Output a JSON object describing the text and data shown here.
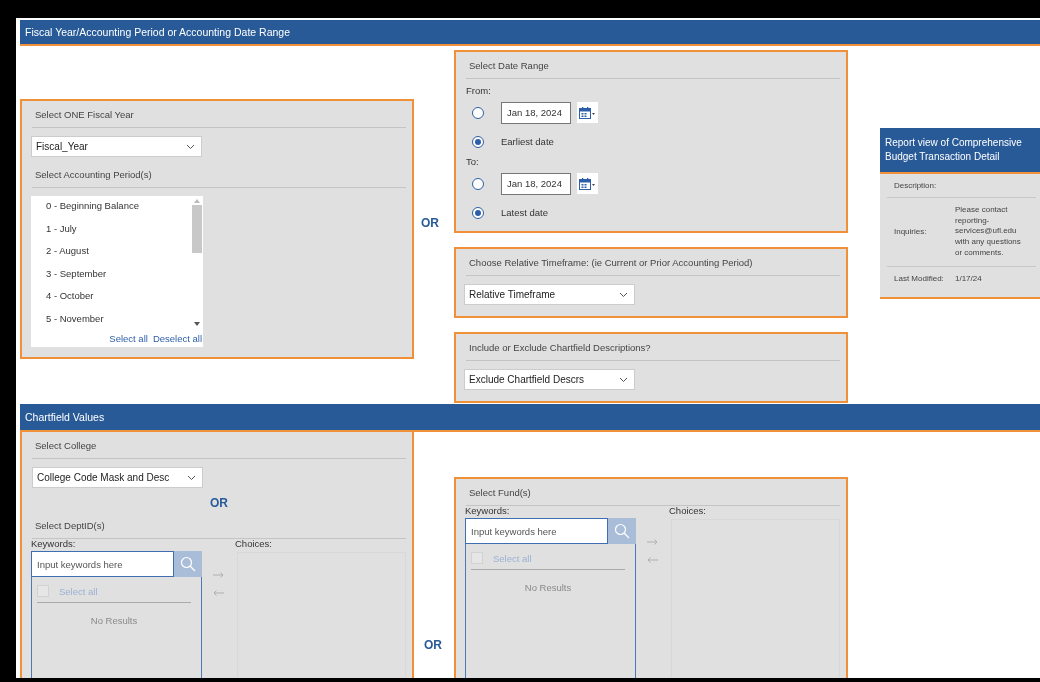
{
  "report_bar": {
    "title": "Fiscal Year/Accounting Period or Accounting Date Range"
  },
  "fiscal_year": {
    "heading": "Select ONE Fiscal Year",
    "dropdown": "Fiscal_Year",
    "periods_heading": "Select Accounting Period(s)",
    "periods": [
      {
        "label": "0 - Beginning Balance",
        "selected": false
      },
      {
        "label": "1 - July",
        "selected": false
      },
      {
        "label": "2 - August",
        "selected": false
      },
      {
        "label": "3 - September",
        "selected": false
      },
      {
        "label": "4 - October",
        "selected": false
      },
      {
        "label": "5 - November",
        "selected": false
      }
    ],
    "select_all": "Select all",
    "deselect_all": "Deselect all"
  },
  "top_or": "OR",
  "date_range": {
    "heading": "Select Date Range",
    "groups": [
      {
        "label": "From:",
        "options": [
          {
            "kind": "date",
            "value": "Jan 18, 2024",
            "selected": false
          },
          {
            "kind": "text",
            "label": "Earliest date",
            "selected": true
          }
        ]
      },
      {
        "label": "To:",
        "options": [
          {
            "kind": "date",
            "value": "Jan 18, 2024",
            "selected": false
          },
          {
            "kind": "text",
            "label": "Latest date",
            "selected": true
          }
        ]
      }
    ]
  },
  "relative_timeframe": {
    "heading": "Choose Relative Timeframe: (ie Current or Prior Accounting Period)",
    "dropdown": "Relative Timeframe"
  },
  "descriptions": {
    "heading": "Include or Exclude Chartfield Descriptions?",
    "dropdown": "Exclude Chartfield Descrs"
  },
  "info_card": {
    "title": "Report view of Comprehensive Budget Transaction Detail",
    "rows": [
      {
        "label": "Description:"
      },
      {
        "label": "Inquiries:",
        "value": "Please contact reporting-services@ufl.edu with any questions or comments."
      },
      {
        "label": "Last Modified:",
        "value": "1/17/24"
      }
    ]
  },
  "chartfield_bar": {
    "title": "Chartfield Values"
  },
  "college": {
    "heading": "Select College",
    "dropdown": "College Code Mask and Desc",
    "or": "OR",
    "dept_heading": "Select DeptID(s)",
    "picker": {
      "keywords_label": "Keywords:",
      "placeholder": "Input keywords here",
      "select_all": "Select all",
      "select_all_checked": false,
      "disabled": true,
      "no_results": "No Results",
      "choices_label": "Choices:"
    }
  },
  "bottom_or": "OR",
  "fund": {
    "heading": "Select Fund(s)",
    "picker": {
      "keywords_label": "Keywords:",
      "placeholder": "Input keywords here",
      "select_all": "Select all",
      "select_all_checked": false,
      "disabled": true,
      "no_results": "No Results",
      "choices_label": "Choices:"
    }
  }
}
